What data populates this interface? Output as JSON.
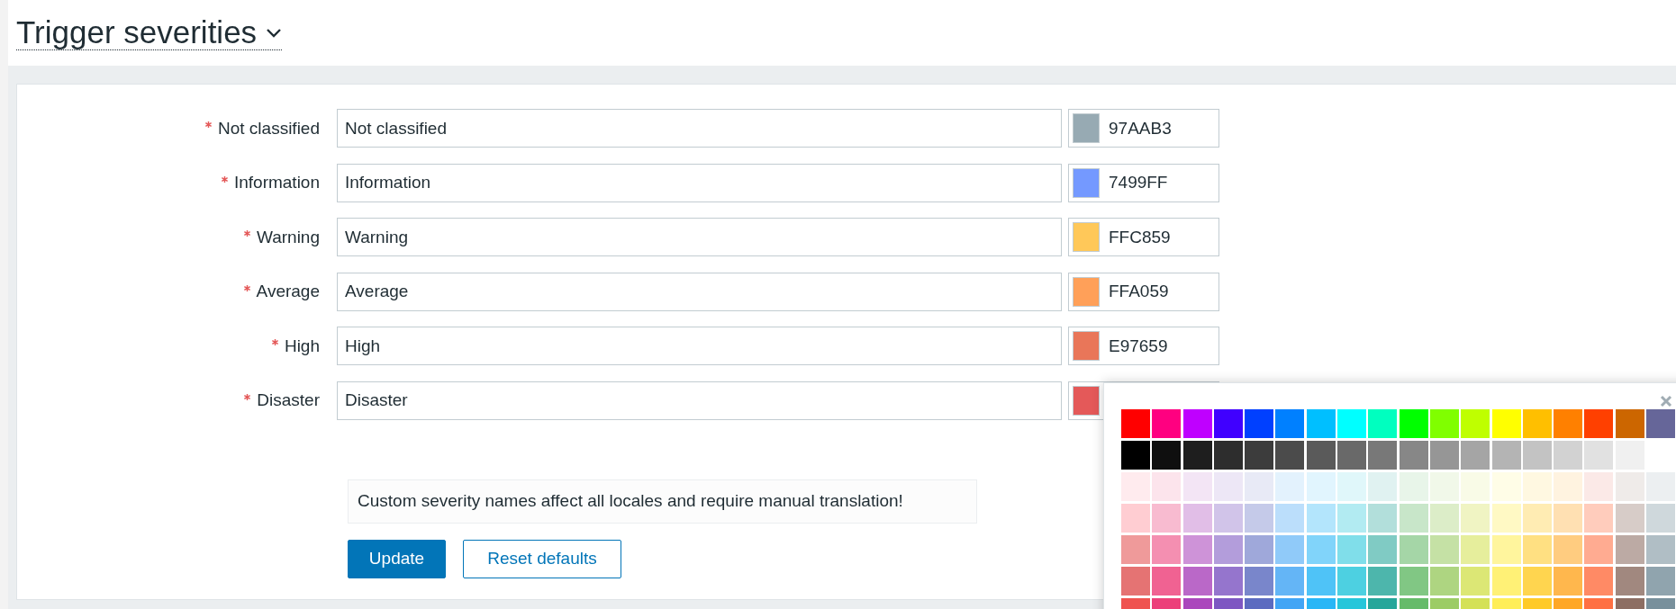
{
  "header": {
    "title": "Trigger severities"
  },
  "severities": [
    {
      "label": "Not classified",
      "required": true,
      "value": "Not classified",
      "color": "#97aab3",
      "hex": "97AAB3"
    },
    {
      "label": "Information",
      "required": true,
      "value": "Information",
      "color": "#7499ff",
      "hex": "7499FF"
    },
    {
      "label": "Warning",
      "required": true,
      "value": "Warning",
      "color": "#ffc859",
      "hex": "FFC859"
    },
    {
      "label": "Average",
      "required": true,
      "value": "Average",
      "color": "#ffa059",
      "hex": "FFA059"
    },
    {
      "label": "High",
      "required": true,
      "value": "High",
      "color": "#e97659",
      "hex": "E97659"
    },
    {
      "label": "Disaster",
      "required": true,
      "value": "Disaster",
      "color": "#e45959"
    }
  ],
  "note": "Custom severity names affect all locales and require manual translation!",
  "buttons": [
    {
      "label": "Update",
      "kind": "primary"
    },
    {
      "label": "Reset defaults",
      "kind": "secondary"
    }
  ],
  "color_picker": {
    "rows": [
      [
        {
          "color": "#ff0000"
        },
        {
          "color": "#ff0080"
        },
        {
          "color": "#bf00ff"
        },
        {
          "color": "#4000ff"
        },
        {
          "color": "#0040ff"
        },
        {
          "color": "#0080ff"
        },
        {
          "color": "#00bfff"
        },
        {
          "color": "#00ffff"
        },
        {
          "color": "#00ffbf"
        },
        {
          "color": "#00ff00"
        },
        {
          "color": "#80ff00"
        },
        {
          "color": "#bfff00"
        },
        {
          "color": "#ffff00"
        },
        {
          "color": "#ffbf00"
        },
        {
          "color": "#ff8000"
        },
        {
          "color": "#ff4000"
        },
        {
          "color": "#cc6600"
        },
        {
          "color": "#666699"
        }
      ],
      [
        {
          "color": "#000000"
        },
        {
          "color": "#0f0f0f"
        },
        {
          "color": "#1e1e1e"
        },
        {
          "color": "#2d2d2d"
        },
        {
          "color": "#3c3c3c"
        },
        {
          "color": "#4b4b4b"
        },
        {
          "color": "#5a5a5a"
        },
        {
          "color": "#696969"
        },
        {
          "color": "#787878"
        },
        {
          "color": "#878787"
        },
        {
          "color": "#969696"
        },
        {
          "color": "#a5a5a5"
        },
        {
          "color": "#b4b4b4"
        },
        {
          "color": "#c3c3c3"
        },
        {
          "color": "#d2d2d2"
        },
        {
          "color": "#e1e1e1"
        },
        {
          "color": "#f0f0f0"
        }
      ],
      [
        {
          "color": "#ffebee"
        },
        {
          "color": "#fce4ec"
        },
        {
          "color": "#f3e5f5"
        },
        {
          "color": "#ede7f6"
        },
        {
          "color": "#e8eaf6"
        },
        {
          "color": "#e3f2fd"
        },
        {
          "color": "#e1f5fe"
        },
        {
          "color": "#e0f7fa"
        },
        {
          "color": "#e0f2f1"
        },
        {
          "color": "#e8f5e9"
        },
        {
          "color": "#f1f8e9"
        },
        {
          "color": "#f9fbe7"
        },
        {
          "color": "#fffde7"
        },
        {
          "color": "#fff8e1"
        },
        {
          "color": "#fff3e0"
        },
        {
          "color": "#fbe9e7"
        },
        {
          "color": "#efebe9"
        },
        {
          "color": "#eceff1"
        }
      ],
      [
        {
          "color": "#ffcdd2"
        },
        {
          "color": "#f8bbd0"
        },
        {
          "color": "#e1bee7"
        },
        {
          "color": "#d1c4e9"
        },
        {
          "color": "#c5cae9"
        },
        {
          "color": "#bbdefb"
        },
        {
          "color": "#b3e5fc"
        },
        {
          "color": "#b2ebf2"
        },
        {
          "color": "#b2dfdb"
        },
        {
          "color": "#c8e6c9"
        },
        {
          "color": "#dcedc8"
        },
        {
          "color": "#f0f4c3"
        },
        {
          "color": "#fff9c4"
        },
        {
          "color": "#ffecb3"
        },
        {
          "color": "#ffe0b2"
        },
        {
          "color": "#ffccbc"
        },
        {
          "color": "#d7ccc8"
        },
        {
          "color": "#cfd8dc"
        }
      ],
      [
        {
          "color": "#ef9a9a"
        },
        {
          "color": "#f48fb1"
        },
        {
          "color": "#ce93d8"
        },
        {
          "color": "#b39ddb"
        },
        {
          "color": "#9fa8da"
        },
        {
          "color": "#90caf9"
        },
        {
          "color": "#81d4fa"
        },
        {
          "color": "#80deea"
        },
        {
          "color": "#80cbc4"
        },
        {
          "color": "#a5d6a7"
        },
        {
          "color": "#c5e1a5"
        },
        {
          "color": "#e6ee9c"
        },
        {
          "color": "#fff59d"
        },
        {
          "color": "#ffe082"
        },
        {
          "color": "#ffcc80"
        },
        {
          "color": "#ffab91"
        },
        {
          "color": "#bcaaa4"
        },
        {
          "color": "#b0bec5"
        }
      ],
      [
        {
          "color": "#e57373"
        },
        {
          "color": "#f06292"
        },
        {
          "color": "#ba68c8"
        },
        {
          "color": "#9575cd"
        },
        {
          "color": "#7986cb"
        },
        {
          "color": "#64b5f6"
        },
        {
          "color": "#4fc3f7"
        },
        {
          "color": "#4dd0e1"
        },
        {
          "color": "#4db6ac"
        },
        {
          "color": "#81c784"
        },
        {
          "color": "#aed581"
        },
        {
          "color": "#dce775"
        },
        {
          "color": "#fff176"
        },
        {
          "color": "#ffd54f"
        },
        {
          "color": "#ffb74d"
        },
        {
          "color": "#ff8a65"
        },
        {
          "color": "#a1887f"
        },
        {
          "color": "#90a4ae"
        }
      ],
      [
        {
          "color": "#ef5350"
        },
        {
          "color": "#ec407a"
        },
        {
          "color": "#ab47bc"
        },
        {
          "color": "#7e57c2"
        },
        {
          "color": "#5c6bc0"
        },
        {
          "color": "#42a5f5"
        },
        {
          "color": "#29b6f6"
        },
        {
          "color": "#26c6da"
        },
        {
          "color": "#26a69a"
        },
        {
          "color": "#66bb6a"
        },
        {
          "color": "#9ccc65"
        },
        {
          "color": "#d4e157"
        },
        {
          "color": "#ffee58"
        },
        {
          "color": "#ffca28"
        },
        {
          "color": "#ffa726"
        },
        {
          "color": "#ff7043"
        },
        {
          "color": "#8d6e63"
        },
        {
          "color": "#78909c"
        }
      ]
    ]
  }
}
